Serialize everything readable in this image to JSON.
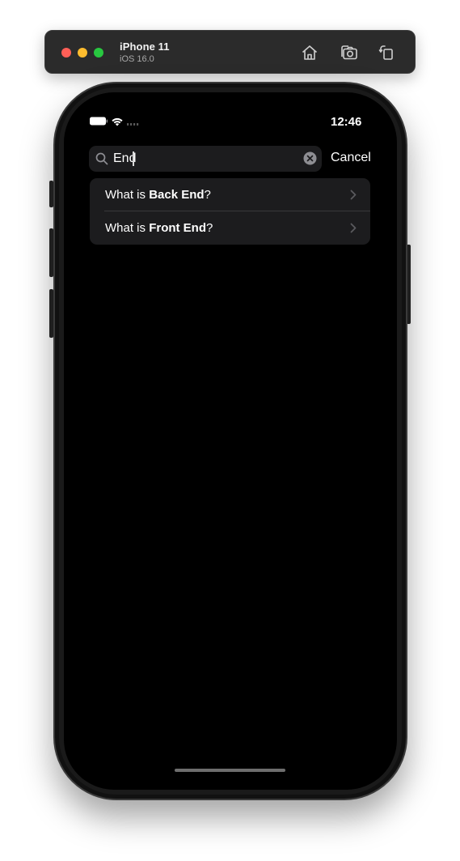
{
  "simulator": {
    "device_name": "iPhone 11",
    "os_version": "iOS 16.0",
    "toolbar_icons": [
      "home-icon",
      "screenshot-icon",
      "rotate-icon"
    ]
  },
  "status_bar": {
    "time": "12:46"
  },
  "search": {
    "query": "End",
    "cancel_label": "Cancel"
  },
  "results": [
    {
      "prefix": "What is ",
      "highlight": "Back End",
      "suffix": "?"
    },
    {
      "prefix": "What is ",
      "highlight": "Front End",
      "suffix": "?"
    }
  ],
  "colors": {
    "screen_bg": "#000000",
    "field_bg": "#1c1c1e",
    "text": "#ffffff",
    "secondary": "#8e8e93"
  }
}
